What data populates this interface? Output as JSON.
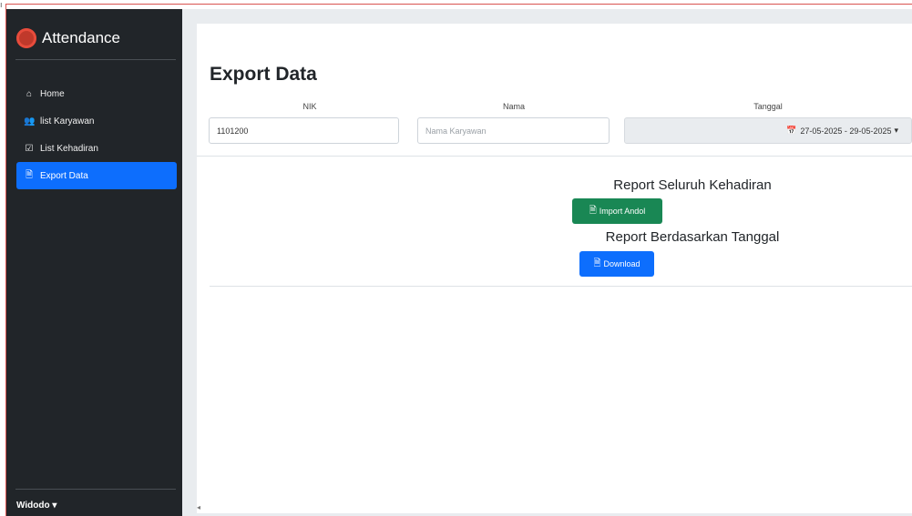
{
  "sidebar": {
    "brand": "Attendance",
    "items": [
      {
        "label": "Home",
        "icon": "home-icon",
        "glyph": "⌂",
        "active": false
      },
      {
        "label": "list Karyawan",
        "icon": "users-icon",
        "glyph": "👥",
        "active": false
      },
      {
        "label": "List Kehadiran",
        "icon": "check-square-icon",
        "glyph": "☑",
        "active": false
      },
      {
        "label": "Export Data",
        "icon": "file-icon",
        "glyph": "🗎",
        "active": true
      }
    ],
    "user": "Widodo"
  },
  "main": {
    "title": "Export Data",
    "filters": {
      "nik_label": "NIK",
      "nik_value": "1101200",
      "nama_label": "Nama",
      "nama_placeholder": "Nama Karyawan",
      "tanggal_label": "Tanggal",
      "tanggal_value": "27-05-2025 - 29-05-2025"
    },
    "report_all": {
      "title": "Report Seluruh Kehadiran",
      "button": "Import Andol"
    },
    "report_date": {
      "title": "Report Berdasarkan Tanggal",
      "button": "Download"
    }
  },
  "colors": {
    "sidebar": "#212529",
    "active": "#0d6efd",
    "excel": "#198754",
    "download": "#0d6efd"
  }
}
